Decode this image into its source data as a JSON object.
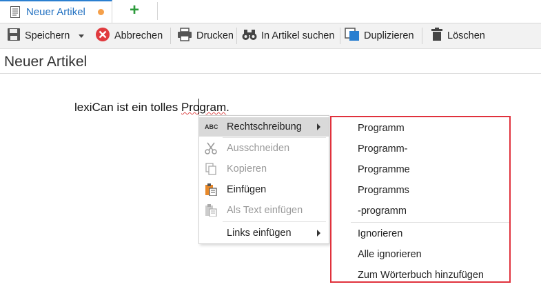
{
  "tab": {
    "title": "Neuer Artikel"
  },
  "toolbar": {
    "save": "Speichern",
    "cancel": "Abbrechen",
    "print": "Drucken",
    "search": "In Artikel suchen",
    "duplicate": "Duplizieren",
    "delete": "Löschen"
  },
  "page": {
    "title": "Neuer Artikel"
  },
  "editor": {
    "text_before": "lexiCan ist ein tolles ",
    "misspelled": "Program",
    "text_after": "."
  },
  "context_menu": {
    "spelling": "Rechtschreibung",
    "cut": "Ausschneiden",
    "copy": "Kopieren",
    "paste": "Einfügen",
    "paste_text": "Als Text einfügen",
    "insert_links": "Links einfügen"
  },
  "spelling_submenu": {
    "suggestions": [
      "Programm",
      "Programm-",
      "Programme",
      "Programms",
      "-programm"
    ],
    "ignore": "Ignorieren",
    "ignore_all": "Alle ignorieren",
    "add_dictionary": "Zum Wörterbuch hinzufügen"
  },
  "colors": {
    "accent": "#2a7fd0",
    "highlight_border": "#e0313c",
    "unsaved_dot": "#f5a04a",
    "add": "#2b9a3a"
  }
}
